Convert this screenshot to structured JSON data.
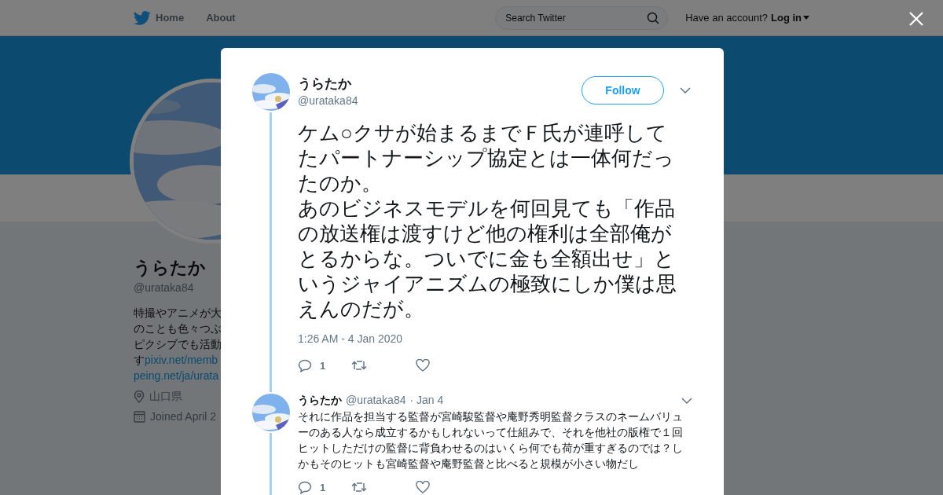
{
  "nav": {
    "items": [
      "Home",
      "About"
    ],
    "search": {
      "placeholder": "Search Twitter"
    },
    "account_prompt": "Have an account?",
    "login": "Log in"
  },
  "profile": {
    "name": "うらたか",
    "handle": "@urataka84",
    "bio_lines": [
      "特撮やアニメが大",
      "のことも色々つぶ",
      "ピクシブでも活動"
    ],
    "bio_last": "す",
    "links": [
      "pixiv.net/memb",
      "peing.net/ja/urata"
    ],
    "location": "山口県",
    "joined": "Joined April 2"
  },
  "modal": {
    "tweet": {
      "name": "うらたか",
      "handle": "@urataka84",
      "follow": "Follow",
      "paragraphs": [
        "ケム○クサが始まるまでＦ氏が連呼してたパートナーシップ協定とは一体何だったのか。",
        "あのビジネスモデルを何回見ても「作品の放送権は渡すけど他の権利は全部俺がとるからな。ついでに金も全額出せ」というジャイアニズムの極致にしか僕は思えんのだが。"
      ],
      "timestamp": "1:26 AM - 4 Jan 2020",
      "replies": "1"
    },
    "reply": {
      "name": "うらたか",
      "handle": "@urataka84",
      "date": "· Jan 4",
      "text": "それに作品を担当する監督が宮崎駿監督や庵野秀明監督クラスのネームバリューのある人なら成立するかもしれないって仕組みで、それを他社の版権で１回ヒットしただけの監督に背負わせるのはいくら何でも荷が重すぎるのでは？しかもそのヒットも宮崎監督や庵野監督と比べると規模が小さい物だし",
      "replies": "1"
    }
  }
}
